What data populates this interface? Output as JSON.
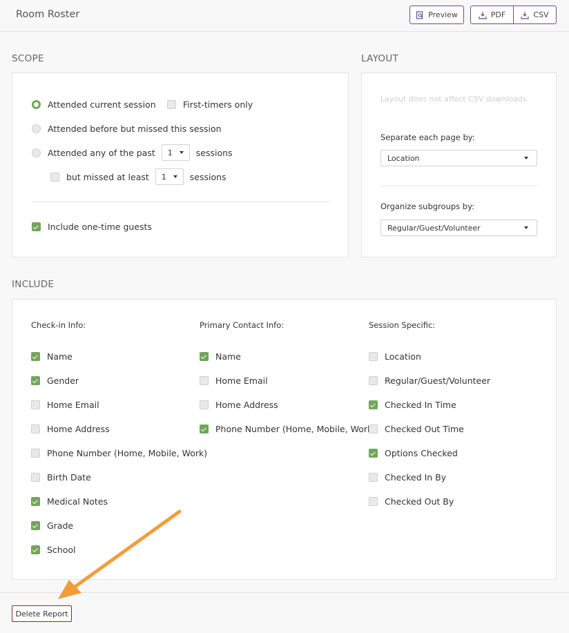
{
  "header": {
    "title": "Room Roster",
    "preview_label": "Preview",
    "pdf_label": "PDF",
    "csv_label": "CSV"
  },
  "scope": {
    "title": "SCOPE",
    "attended_current": "Attended current session",
    "first_timers": "First-timers only",
    "attended_before_missed": "Attended before but missed this session",
    "attended_any_past": "Attended any of the past",
    "past_sessions_value": "1",
    "sessions_word": "sessions",
    "but_missed": "but missed at least",
    "missed_sessions_value": "1",
    "sessions_word2": "sessions",
    "include_guests": "Include one-time guests"
  },
  "layout": {
    "title": "LAYOUT",
    "note": "Layout does not affect CSV downloads.",
    "separate_label": "Separate each page by:",
    "separate_value": "Location",
    "organize_label": "Organize subgroups by:",
    "organize_value": "Regular/Guest/Volunteer"
  },
  "include": {
    "title": "INCLUDE",
    "checkin": {
      "header": "Check-in Info:",
      "items": [
        {
          "label": "Name",
          "checked": true
        },
        {
          "label": "Gender",
          "checked": true
        },
        {
          "label": "Home Email",
          "checked": false
        },
        {
          "label": "Home Address",
          "checked": false
        },
        {
          "label": "Phone Number (Home, Mobile, Work)",
          "checked": false
        },
        {
          "label": "Birth Date",
          "checked": false
        },
        {
          "label": "Medical Notes",
          "checked": true
        },
        {
          "label": "Grade",
          "checked": true
        },
        {
          "label": "School",
          "checked": true
        }
      ]
    },
    "primary": {
      "header": "Primary Contact Info:",
      "items": [
        {
          "label": "Name",
          "checked": true
        },
        {
          "label": "Home Email",
          "checked": false
        },
        {
          "label": "Home Address",
          "checked": false
        },
        {
          "label": "Phone Number (Home, Mobile, Work)",
          "checked": true
        }
      ]
    },
    "session": {
      "header": "Session Specific:",
      "items": [
        {
          "label": "Location",
          "checked": false
        },
        {
          "label": "Regular/Guest/Volunteer",
          "checked": false
        },
        {
          "label": "Checked In Time",
          "checked": true
        },
        {
          "label": "Checked Out Time",
          "checked": false
        },
        {
          "label": "Options Checked",
          "checked": true
        },
        {
          "label": "Checked In By",
          "checked": false
        },
        {
          "label": "Checked Out By",
          "checked": false
        }
      ]
    }
  },
  "footer": {
    "delete_label": "Delete Report"
  },
  "colors": {
    "accent": "#72a55b",
    "header_button_border": "#6b4d8a",
    "delete_border": "#8a2b2b",
    "annotation_arrow": "#f39c3a"
  }
}
